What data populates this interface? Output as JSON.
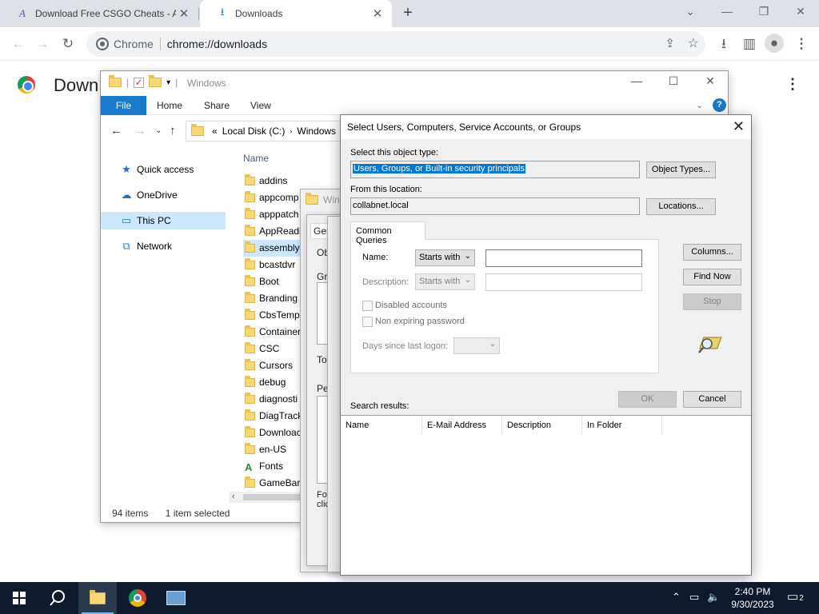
{
  "browser": {
    "tabs": [
      {
        "title": "Download Free CSGO Cheats - A",
        "active": false
      },
      {
        "title": "Downloads",
        "active": true
      }
    ],
    "omnibox": {
      "origin": "Chrome",
      "url": "chrome://downloads"
    },
    "page_title": "Down"
  },
  "explorer": {
    "title": "Windows",
    "ribbon_tabs": [
      "File",
      "Home",
      "Share",
      "View"
    ],
    "address": {
      "drive": "Local Disk (C:)",
      "folder": "Windows"
    },
    "nav": [
      "Quick access",
      "OneDrive",
      "This PC",
      "Network"
    ],
    "column_header": "Name",
    "files": [
      "addins",
      "appcomp",
      "apppatch",
      "AppReadi",
      "assembly",
      "bcastdvr",
      "Boot",
      "Branding",
      "CbsTemp",
      "Container",
      "CSC",
      "Cursors",
      "debug",
      "diagnosti",
      "DiagTrack",
      "Downloac",
      "en-US",
      "Fonts",
      "GameBarF"
    ],
    "selected_file": "assembly",
    "status": {
      "items": "94 items",
      "selected": "1 item selected"
    }
  },
  "prop_dialog_fragments": {
    "title": "Win",
    "tab": "Gen",
    "ob": "Ob",
    "gro": "Gro",
    "to": "To",
    "pe": "Pe",
    "fo": "Fo",
    "cli": "clic"
  },
  "select_dialog": {
    "title": "Select Users, Computers, Service Accounts, or Groups",
    "object_type_label": "Select this object type:",
    "object_type_value": "Users, Groups, or Built-in security principals",
    "object_types_button": "Object Types...",
    "location_label": "From this location:",
    "location_value": "collabnet.local",
    "locations_button": "Locations...",
    "tab": "Common Queries",
    "name_label": "Name:",
    "name_mode": "Starts with",
    "description_label": "Description:",
    "description_mode": "Starts with",
    "disabled_accounts": "Disabled accounts",
    "non_expiring": "Non expiring password",
    "days_since_logon": "Days since last logon:",
    "columns_button": "Columns...",
    "find_now_button": "Find Now",
    "stop_button": "Stop",
    "ok_button": "OK",
    "cancel_button": "Cancel",
    "search_results_label": "Search results:",
    "result_columns": [
      "Name",
      "E-Mail Address",
      "Description",
      "In Folder"
    ]
  },
  "taskbar": {
    "time": "2:40 PM",
    "date": "9/30/2023",
    "notification_count": "2"
  }
}
